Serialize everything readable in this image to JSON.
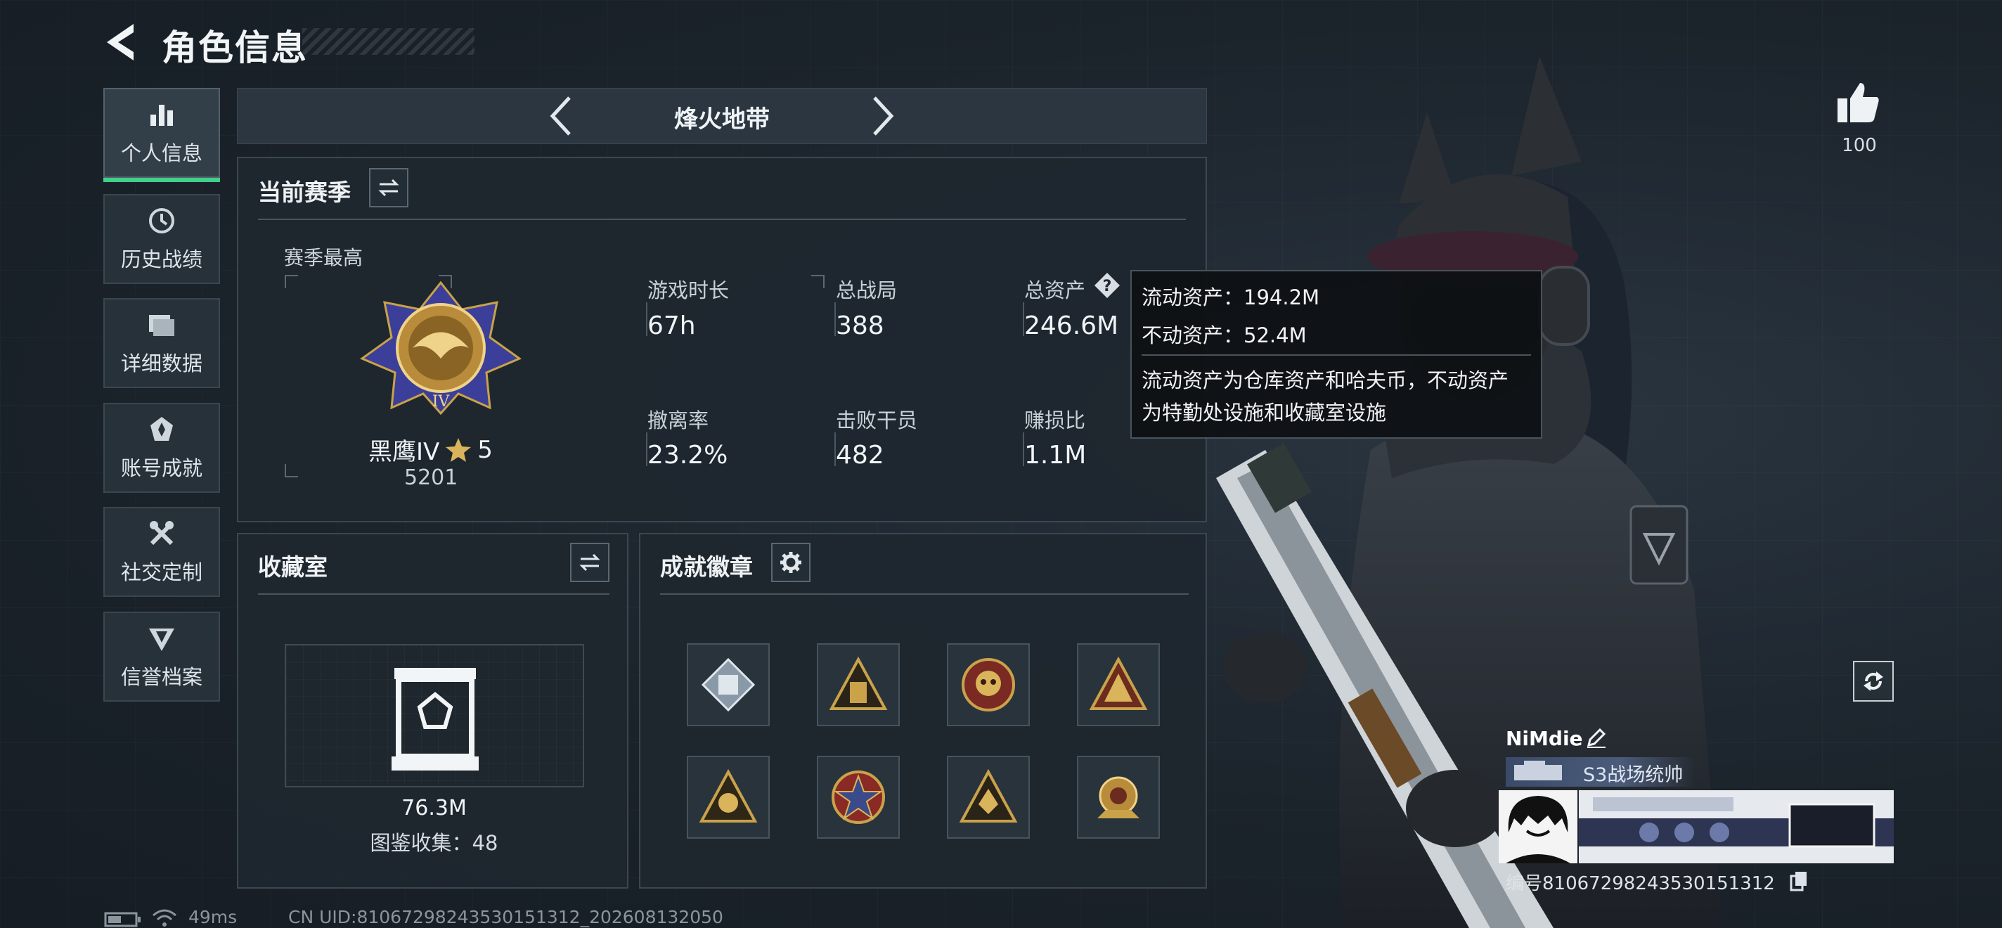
{
  "header": {
    "title": "角色信息"
  },
  "sidebar": {
    "items": [
      {
        "label": "个人信息",
        "icon": "bar-chart-icon",
        "active": true
      },
      {
        "label": "历史战绩",
        "icon": "history-icon"
      },
      {
        "label": "详细数据",
        "icon": "folder-icon"
      },
      {
        "label": "账号成就",
        "icon": "medal-icon"
      },
      {
        "label": "社交定制",
        "icon": "tools-icon"
      },
      {
        "label": "信誉档案",
        "icon": "shield-icon"
      }
    ]
  },
  "mode": {
    "label": "烽火地带"
  },
  "season": {
    "title": "当前赛季",
    "subtitle": "赛季最高",
    "rank_name": "黑鹰IV",
    "rank_stars": "5",
    "rank_points": "5201",
    "stats": [
      {
        "label": "游戏时长",
        "value": "67h"
      },
      {
        "label": "总战局",
        "value": "388"
      },
      {
        "label": "总资产",
        "value": "246.6M"
      },
      {
        "label": "撤离率",
        "value": "23.2%"
      },
      {
        "label": "击败干员",
        "value": "482"
      },
      {
        "label": "赚损比",
        "value": "1.1M"
      }
    ]
  },
  "tooltip": {
    "liquid": "流动资产：194.2M",
    "fixed": "不动资产：52.4M",
    "desc_line1": "流动资产为仓库资产和哈夫币，不动资产",
    "desc_line2": "为特勤处设施和收藏室设施"
  },
  "collection": {
    "title": "收藏室",
    "value": "76.3M",
    "count_label": "图鉴收集：48"
  },
  "badges": {
    "title": "成就徽章",
    "items": [
      "diamond-badge-icon",
      "triangle-badge-icon",
      "skull-badge-icon",
      "triangle-frame-badge-icon",
      "skull-triangle-badge-icon",
      "star-circle-badge-icon",
      "fist-triangle-badge-icon",
      "gear-badge-icon"
    ]
  },
  "likes": {
    "count": "100"
  },
  "player": {
    "name": "NiMdie",
    "title": "S3战场统帅",
    "uid": "编号810672982435301513​12"
  },
  "footer": {
    "ping": "49ms",
    "uid": "CN UID:810672982435301513​12_202608132050"
  },
  "colors": {
    "accent": "#3fd08a",
    "panel": "#1e272f",
    "gold": "#c9a24a"
  }
}
